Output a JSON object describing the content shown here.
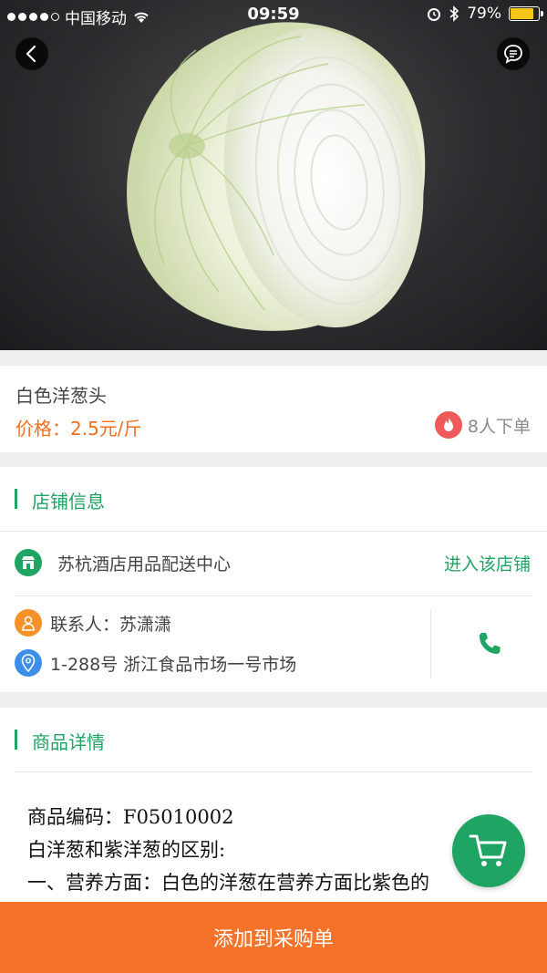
{
  "status_bar": {
    "carrier": "中国移动",
    "time": "09:59",
    "battery": "79%"
  },
  "product": {
    "name": "白色洋葱头",
    "price": "价格：2.5元/斤",
    "order_count": "8人下单"
  },
  "store_section": {
    "title": "店铺信息",
    "store_name": "苏杭酒店用品配送中心",
    "enter_store": "进入该店铺",
    "contact": "联系人：苏潇潇",
    "address": "1-288号 浙江食品市场一号市场"
  },
  "detail_section": {
    "title": "商品详情",
    "lines": [
      "商品编码：F05010002",
      "白洋葱和紫洋葱的区别:",
      "一、营养方面：白色的洋葱在营养方面比紫色的"
    ]
  },
  "bottom_bar": {
    "label": "添加到采购单"
  },
  "colors": {
    "accent_green": "#1fa463",
    "price_orange": "#f36f21",
    "bottom_bar": "#f7722a",
    "fire_red": "#f05a5a",
    "contact_orange": "#f7922a",
    "location_blue": "#3d8ee8"
  },
  "icons": {
    "back": "chevron-left-icon",
    "message": "chat-bubble-icon",
    "fire": "fire-icon",
    "store": "store-icon",
    "contact": "person-icon",
    "location": "location-pin-icon",
    "phone": "phone-icon",
    "cart": "cart-icon"
  }
}
